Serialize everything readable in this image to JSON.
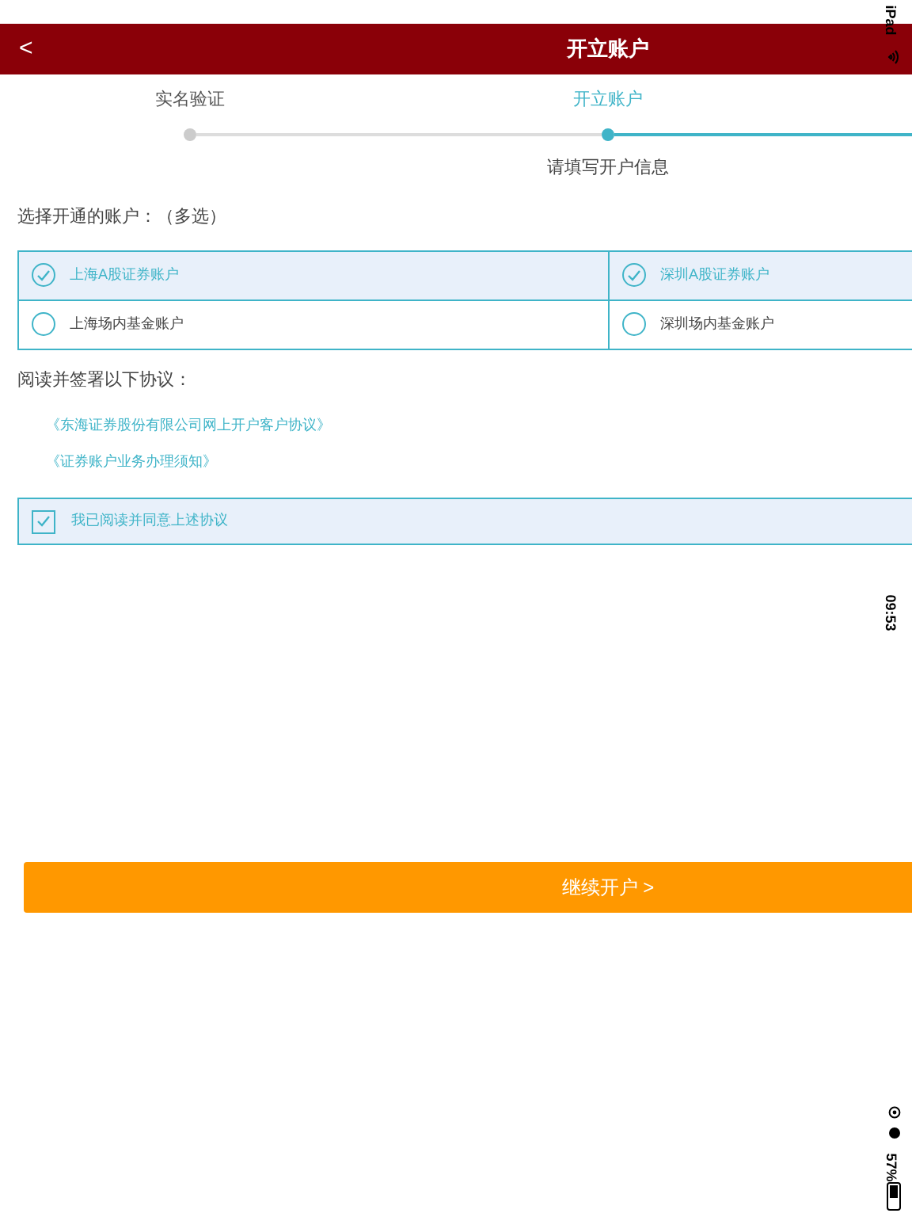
{
  "status_bar": {
    "device": "iPad",
    "time": "09:53",
    "battery": "57%"
  },
  "nav": {
    "back": "<",
    "title": "开立账户"
  },
  "steps": [
    {
      "label": "实名验证",
      "selected": false
    },
    {
      "label": "开立账户",
      "selected": true,
      "hint": "请填写开户信息"
    }
  ],
  "accounts": {
    "label": "选择开通的账户：（多选）",
    "items": [
      {
        "label": "上海A股证券账户",
        "checked": true
      },
      {
        "label": "深圳A股证券账户",
        "checked": true
      },
      {
        "label": "上海场内基金账户",
        "checked": false
      },
      {
        "label": "深圳场内基金账户",
        "checked": false
      }
    ]
  },
  "agreements": {
    "label": "阅读并签署以下协议：",
    "links": [
      "《东海证券股份有限公司网上开户客户协议》",
      "《证券账户业务办理须知》"
    ],
    "consent": {
      "label": "我已阅读并同意上述协议",
      "checked": true
    }
  },
  "continue_button": "继续开户 >"
}
